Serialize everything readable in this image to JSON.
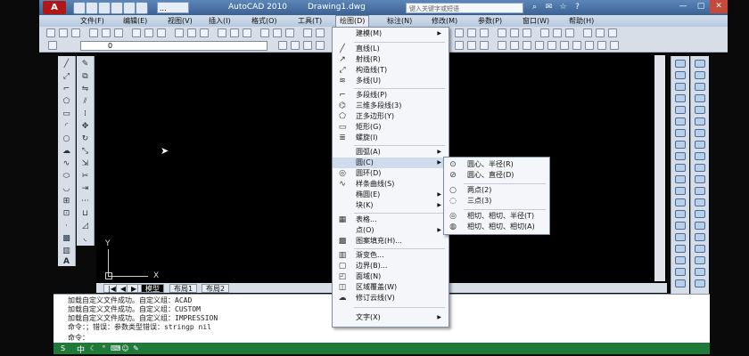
{
  "titlebar": {
    "app_logo": "A",
    "workspace": "...",
    "app_title": "AutoCAD 2010",
    "doc_title": "Drawing1.dwg",
    "search_placeholder": "键入关键字或短语"
  },
  "menubar": [
    {
      "id": "file",
      "label": "文件(F)"
    },
    {
      "id": "edit",
      "label": "编辑(E)"
    },
    {
      "id": "view",
      "label": "视图(V)"
    },
    {
      "id": "insert",
      "label": "插入(I)"
    },
    {
      "id": "format",
      "label": "格式(O)"
    },
    {
      "id": "tools",
      "label": "工具(T)"
    },
    {
      "id": "draw",
      "label": "绘图(D)"
    },
    {
      "id": "dimension",
      "label": "标注(N)"
    },
    {
      "id": "modify",
      "label": "修改(M)"
    },
    {
      "id": "parameter",
      "label": "参数(P)"
    },
    {
      "id": "window",
      "label": "窗口(W)"
    },
    {
      "id": "help",
      "label": "帮助(H)"
    }
  ],
  "layer": {
    "current": "0"
  },
  "draw_menu": {
    "items": [
      {
        "label": "建模(M)",
        "icon": "",
        "arrow": "▶"
      },
      {
        "label": "直线(L)",
        "icon": "╱",
        "arrow": ""
      },
      {
        "label": "射线(R)",
        "icon": "↗",
        "arrow": ""
      },
      {
        "label": "构造线(T)",
        "icon": "⤢",
        "arrow": ""
      },
      {
        "label": "多线(U)",
        "icon": "≋",
        "arrow": ""
      },
      {
        "label": "多段线(P)",
        "icon": "⌐",
        "arrow": ""
      },
      {
        "label": "三维多段线(3)",
        "icon": "⌬",
        "arrow": ""
      },
      {
        "label": "正多边形(Y)",
        "icon": "⬠",
        "arrow": ""
      },
      {
        "label": "矩形(G)",
        "icon": "▭",
        "arrow": ""
      },
      {
        "label": "螺旋(I)",
        "icon": "≣",
        "arrow": ""
      },
      {
        "label": "圆弧(A)",
        "icon": "",
        "arrow": "▶"
      },
      {
        "label": "圆(C)",
        "icon": "",
        "arrow": "▶"
      },
      {
        "label": "圆环(D)",
        "icon": "◎",
        "arrow": ""
      },
      {
        "label": "样条曲线(S)",
        "icon": "∿",
        "arrow": ""
      },
      {
        "label": "椭圆(E)",
        "icon": "",
        "arrow": "▶"
      },
      {
        "label": "块(K)",
        "icon": "",
        "arrow": "▶"
      },
      {
        "label": "表格...",
        "icon": "▦",
        "arrow": ""
      },
      {
        "label": "点(O)",
        "icon": "",
        "arrow": "▶"
      },
      {
        "label": "图案填充(H)...",
        "icon": "▩",
        "arrow": ""
      },
      {
        "label": "渐变色...",
        "icon": "▥",
        "arrow": ""
      },
      {
        "label": "边界(B)...",
        "icon": "▢",
        "arrow": ""
      },
      {
        "label": "面域(N)",
        "icon": "◰",
        "arrow": ""
      },
      {
        "label": "区域覆盖(W)",
        "icon": "◫",
        "arrow": ""
      },
      {
        "label": "修订云线(V)",
        "icon": "☁",
        "arrow": ""
      },
      {
        "label": "文字(X)",
        "icon": "",
        "arrow": "▶"
      }
    ]
  },
  "circle_menu": {
    "items": [
      {
        "label": "圆心、半径(R)",
        "icon": "⊙"
      },
      {
        "label": "圆心、直径(D)",
        "icon": "⊘"
      },
      {
        "label": "两点(2)",
        "icon": "○"
      },
      {
        "label": "三点(3)",
        "icon": "◌"
      },
      {
        "label": "相切、相切、半径(T)",
        "icon": "◎"
      },
      {
        "label": "相切、相切、相切(A)",
        "icon": "◍"
      }
    ]
  },
  "ucs": {
    "x": "X",
    "y": "Y"
  },
  "layout_tabs": [
    "模型",
    "布局1",
    "布局2"
  ],
  "command": {
    "lines": [
      "加载自定义文件成功。自定义组：ACAD",
      "加载自定义文件成功。自定义组：CUSTOM",
      "加载自定义文件成功。自定义组：IMPRESSION",
      "命令：；错误：参数类型错误：stringp nil"
    ],
    "prompt": "命令："
  },
  "status": {
    "lang": "中"
  }
}
